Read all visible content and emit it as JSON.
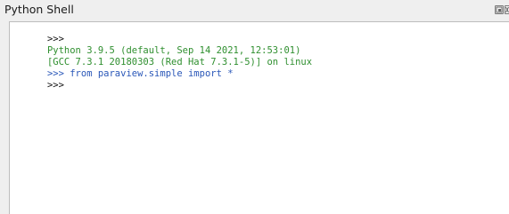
{
  "window": {
    "title": "Python Shell"
  },
  "console": {
    "lines": [
      {
        "text": ">>>",
        "kind": "prompt"
      },
      {
        "text": "Python 3.9.5 (default, Sep 14 2021, 12:53:01)",
        "kind": "output"
      },
      {
        "text": "[GCC 7.3.1 20180303 (Red Hat 7.3.1-5)] on linux",
        "kind": "output"
      },
      {
        "prompt": ">>> ",
        "command": "from paraview.simple import *",
        "kind": "command"
      },
      {
        "text": ">>>",
        "kind": "prompt"
      }
    ]
  },
  "colors": {
    "output": "#2f8f2f",
    "command": "#2a57b8",
    "prompt": "#111111",
    "background": "#ffffff",
    "chrome": "#efefef"
  },
  "icons": {
    "float": "float-icon",
    "close": "close-icon"
  }
}
